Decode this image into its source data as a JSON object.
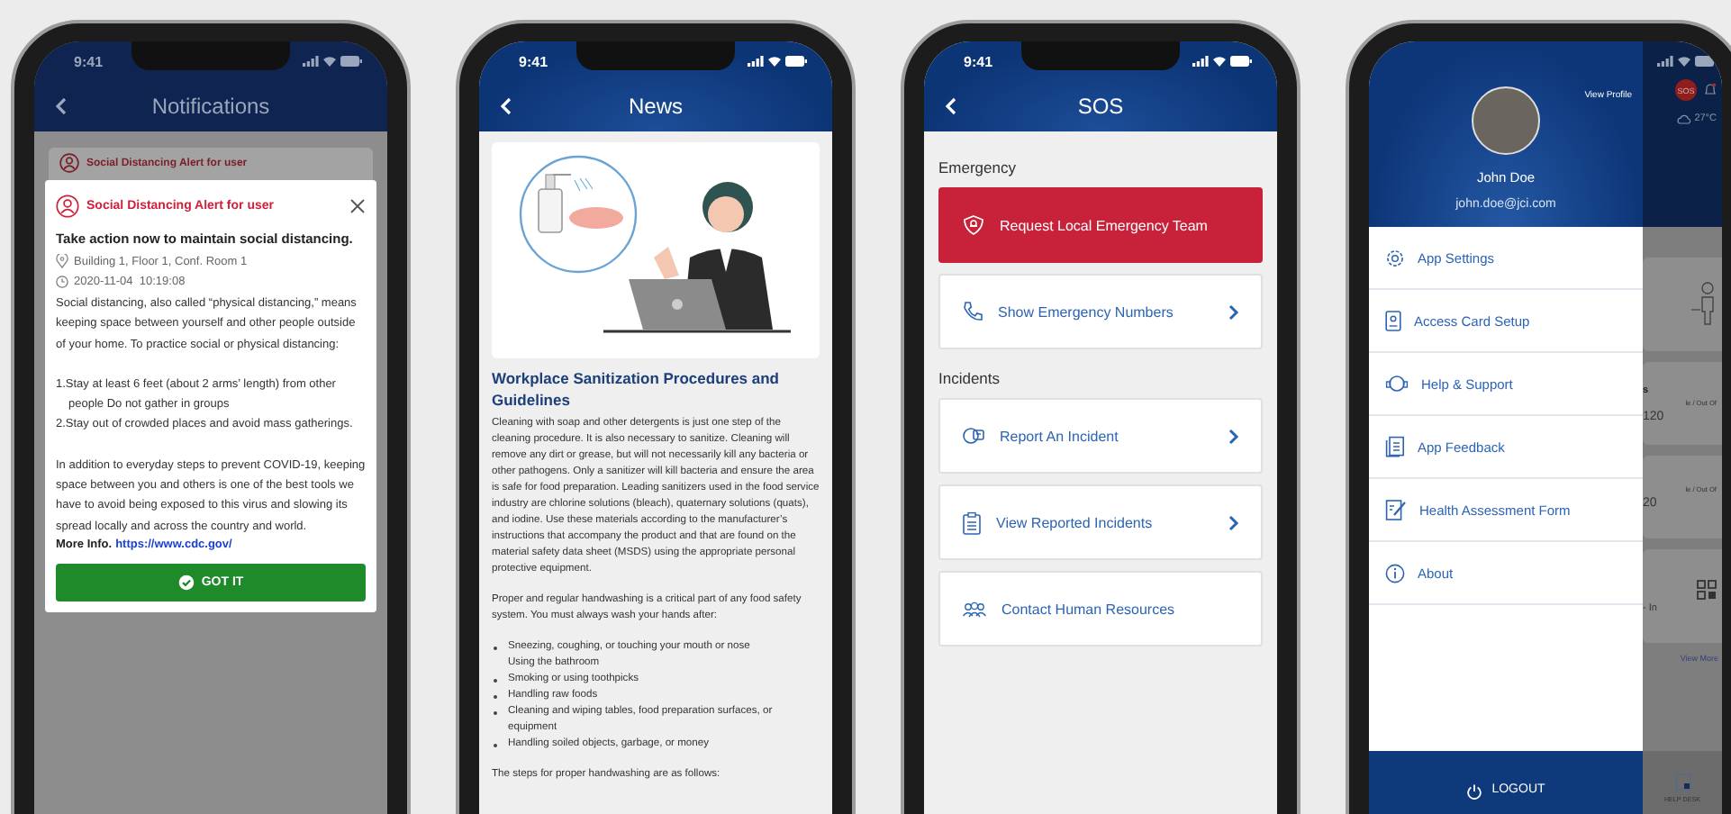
{
  "notifications_screen": {
    "status_time": "9:41",
    "title": "Notifications",
    "background_alert_title": "Social Distancing Alert for user",
    "alert": {
      "title": "Social Distancing Alert for user",
      "heading": "Take action now to maintain social distancing.",
      "location": "Building 1, Floor 1, Conf. Room 1",
      "timestamp": "2020-11-04  10:19:08",
      "intro": "Social distancing, also called “physical distancing,” means keeping space between yourself and other people outside of your home. To practice social or physical distancing:",
      "steps": [
        "1.Stay at least 6 feet (about 2 arms’ length) from other people Do not gather in groups",
        "2.Stay out of crowded places and avoid mass gatherings."
      ],
      "closing": "In addition to everyday steps to prevent COVID-19, keeping space between you and others is one of the best tools we have to avoid being exposed to this virus and slowing its spread locally and across the country and world.",
      "more_info_label": "More Info.",
      "more_info_link": "https://www.cdc.gov/",
      "button": "GOT IT"
    }
  },
  "news_screen": {
    "status_time": "9:41",
    "title": "News",
    "article_title": "Workplace Sanitization Procedures and Guidelines",
    "paragraphs": [
      "Cleaning with soap and other detergents is just one step of the cleaning procedure. It is also necessary to sanitize. Cleaning will remove any dirt or grease, but will not necessarily kill any bacteria or other pathogens. Only a sanitizer will kill bacteria and ensure the area is safe for food preparation. Leading sanitizers used in the food service industry are chlorine solutions (bleach), quaternary solutions (quats), and iodine. Use these materials according to the manufacturer’s instructions that accompany the product and that are found on the material safety data sheet (MSDS) using the appropriate personal protective equipment.",
      "Proper and regular handwashing is a critical part of any food safety system. You must always wash your hands after:"
    ],
    "bullets": [
      "Sneezing, coughing, or touching your mouth or nose\nUsing the bathroom",
      "Smoking or using toothpicks",
      "Handling raw foods",
      "Cleaning and wiping tables, food preparation surfaces, or equipment",
      "Handling soiled objects, garbage, or money"
    ],
    "footer_text": "The steps for proper handwashing are as follows:"
  },
  "sos_screen": {
    "status_time": "9:41",
    "title": "SOS",
    "sections": [
      {
        "heading": "Emergency",
        "items": [
          {
            "kind": "alert",
            "label": "Request Local Emergency Team",
            "chevron": false
          },
          {
            "kind": "link",
            "label": "Show Emergency Numbers",
            "chevron": true
          }
        ]
      },
      {
        "heading": "Incidents",
        "items": [
          {
            "kind": "link",
            "label": "Report An Incident",
            "chevron": true
          },
          {
            "kind": "link",
            "label": "View Reported Incidents",
            "chevron": true
          },
          {
            "kind": "link",
            "label": "Contact Human Resources",
            "chevron": false
          }
        ]
      }
    ]
  },
  "menu_screen": {
    "profile": {
      "view_profile": "View Profile",
      "name": "John Doe",
      "email": "john.doe@jci.com"
    },
    "items": [
      "App Settings",
      "Access Card Setup",
      "Help & Support",
      "App Feedback",
      "Health Assessment Form",
      "About"
    ],
    "logout": "LOGOUT",
    "background": {
      "sos_badge": "SOS",
      "temperature": "27°C",
      "cards": [
        {
          "title": "s",
          "caption": "le / Out Of",
          "value": "120"
        },
        {
          "caption": "le / Out Of",
          "value": "20"
        }
      ],
      "check_in": "- In",
      "view_more": "View More",
      "tab": "HELP DESK"
    }
  }
}
